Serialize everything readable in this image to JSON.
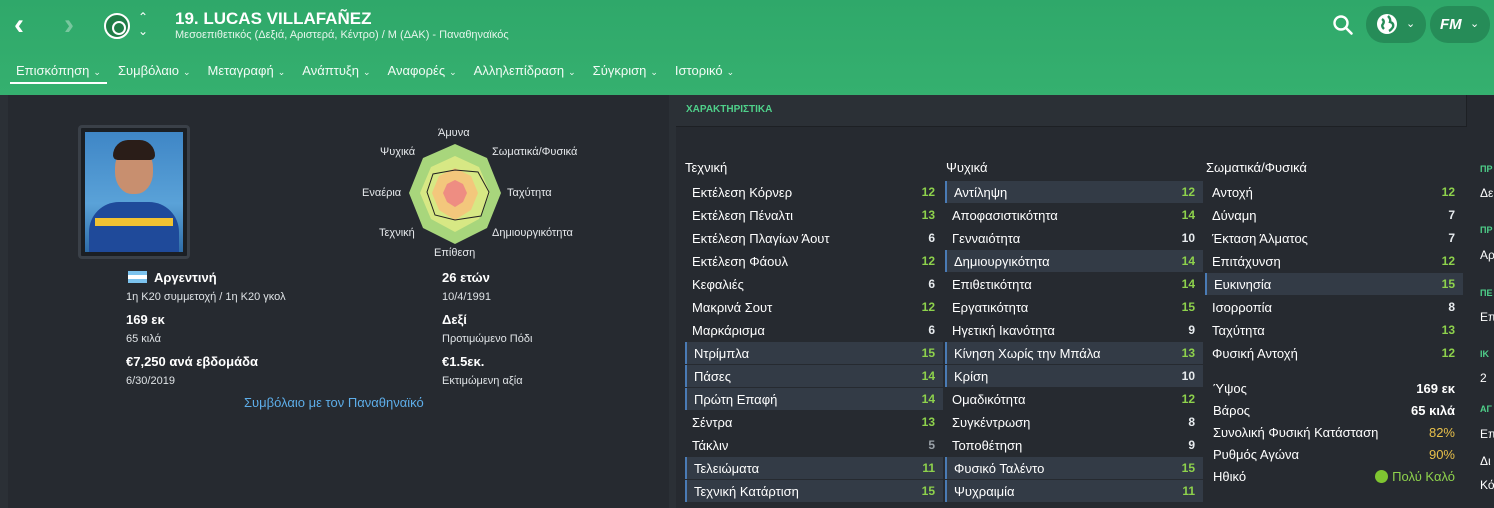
{
  "header": {
    "title": "19. LUCAS VILLAFAÑEZ",
    "subtitle": "Μεσοεπιθετικός (Δεξιά, Αριστερά, Κέντρο) / Μ (ΔΑΚ) - Παναθηναϊκός"
  },
  "tabs": [
    {
      "label": "Επισκόπηση"
    },
    {
      "label": "Συμβόλαιο"
    },
    {
      "label": "Μεταγραφή"
    },
    {
      "label": "Ανάπτυξη"
    },
    {
      "label": "Αναφορές"
    },
    {
      "label": "Αλληλεπίδραση"
    },
    {
      "label": "Σύγκριση"
    },
    {
      "label": "Ιστορικό"
    }
  ],
  "profile": {
    "nationality": "Αργεντινή",
    "caps": "1η Κ20 συμμετοχή / 1η Κ20 γκολ",
    "height": "169 εκ",
    "weight": "65 κιλά",
    "wage": "€7,250 ανά εβδομάδα",
    "contract_end": "6/30/2019",
    "age": "26 ετών",
    "dob": "10/4/1991",
    "foot": "Δεξί",
    "foot_label": "Προτιμώμενο Πόδι",
    "value": "€1.5εκ.",
    "value_label": "Εκτιμώμενη αξία",
    "contract_link": "Συμβόλαιο με τον Παναθηναϊκό"
  },
  "radar": {
    "labels": {
      "top": "Άμυνα",
      "top_right": "Σωματικά/Φυσικά",
      "right": "Ταχύτητα",
      "bottom_right": "Δημιουργικότητα",
      "bottom": "Επίθεση",
      "bottom_left": "Τεχνική",
      "left": "Εναέρια",
      "top_left": "Ψυχικά"
    }
  },
  "attributes": {
    "section_title": "ΧΑΡΑΚΤΗΡΙΣΤΙΚΑ",
    "technical": {
      "title": "Τεχνική",
      "rows": [
        {
          "name": "Εκτέλεση Κόρνερ",
          "value": "12"
        },
        {
          "name": "Εκτέλεση Πέναλτι",
          "value": "13"
        },
        {
          "name": "Εκτέλεση Πλαγίων Άουτ",
          "value": "6"
        },
        {
          "name": "Εκτέλεση Φάουλ",
          "value": "12"
        },
        {
          "name": "Κεφαλιές",
          "value": "6"
        },
        {
          "name": "Μακρινά Σουτ",
          "value": "12"
        },
        {
          "name": "Μαρκάρισμα",
          "value": "6"
        },
        {
          "name": "Ντρίμπλα",
          "value": "15"
        },
        {
          "name": "Πάσες",
          "value": "14"
        },
        {
          "name": "Πρώτη Επαφή",
          "value": "14"
        },
        {
          "name": "Σέντρα",
          "value": "13"
        },
        {
          "name": "Τάκλιν",
          "value": "5"
        },
        {
          "name": "Τελειώματα",
          "value": "11"
        },
        {
          "name": "Τεχνική Κατάρτιση",
          "value": "15"
        }
      ]
    },
    "mental": {
      "title": "Ψυχικά",
      "rows": [
        {
          "name": "Αντίληψη",
          "value": "12"
        },
        {
          "name": "Αποφασιστικότητα",
          "value": "14"
        },
        {
          "name": "Γενναιότητα",
          "value": "10"
        },
        {
          "name": "Δημιουργικότητα",
          "value": "14"
        },
        {
          "name": "Επιθετικότητα",
          "value": "14"
        },
        {
          "name": "Εργατικότητα",
          "value": "15"
        },
        {
          "name": "Ηγετική Ικανότητα",
          "value": "9"
        },
        {
          "name": "Κίνηση Χωρίς την Μπάλα",
          "value": "13"
        },
        {
          "name": "Κρίση",
          "value": "10"
        },
        {
          "name": "Ομαδικότητα",
          "value": "12"
        },
        {
          "name": "Συγκέντρωση",
          "value": "8"
        },
        {
          "name": "Τοποθέτηση",
          "value": "9"
        },
        {
          "name": "Φυσικό Ταλέντο",
          "value": "15"
        },
        {
          "name": "Ψυχραιμία",
          "value": "11"
        }
      ]
    },
    "physical": {
      "title": "Σωματικά/Φυσικά",
      "rows": [
        {
          "name": "Αντοχή",
          "value": "12"
        },
        {
          "name": "Δύναμη",
          "value": "7"
        },
        {
          "name": "Έκταση Άλματος",
          "value": "7"
        },
        {
          "name": "Επιτάχυνση",
          "value": "12"
        },
        {
          "name": "Ευκινησία",
          "value": "15"
        },
        {
          "name": "Ισορροπία",
          "value": "8"
        },
        {
          "name": "Ταχύτητα",
          "value": "13"
        },
        {
          "name": "Φυσική Αντοχή",
          "value": "12"
        }
      ]
    },
    "condition": [
      {
        "name": "Ύψος",
        "value": "169 εκ"
      },
      {
        "name": "Βάρος",
        "value": "65 κιλά"
      },
      {
        "name": "Συνολική Φυσική Κατάσταση",
        "value": "82%"
      },
      {
        "name": "Ρυθμός Αγώνα",
        "value": "90%"
      },
      {
        "name": "Ηθικό",
        "value": "Πολύ Καλό"
      }
    ]
  },
  "edge": {
    "h1": "ΠΡ",
    "t1": "Δε",
    "h2": "ΠΡ",
    "t2": "Αρ",
    "h3": "ΠΕ",
    "t3": "Επ",
    "h4": "ΙΚ",
    "t4": "2",
    "h5": "ΑΓ",
    "t5": "Επ",
    "t6": "Δι",
    "t7": "Κό"
  },
  "colors": {
    "header_green": "#35b06f",
    "good_value": "#8ed24c",
    "link": "#5dade8",
    "highlight_bar": "#4a7bb5"
  }
}
